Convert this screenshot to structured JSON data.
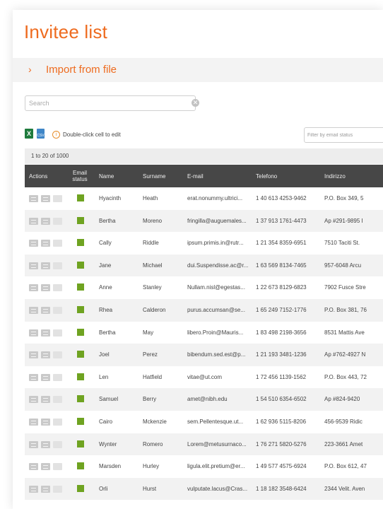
{
  "title": "Invitee list",
  "import": {
    "chevron": "›",
    "label": "Import from file"
  },
  "search": {
    "placeholder": "Search",
    "clear_glyph": "✕"
  },
  "toolbar": {
    "excel_glyph": "X",
    "csv_glyph": "CSV",
    "info_glyph": "i",
    "hint": "Double-click cell to edit",
    "filter_placeholder": "Filter by email status"
  },
  "range": "1 to 20 of 1000",
  "columns": {
    "actions": "Actions",
    "email_status": "Email status",
    "name": "Name",
    "surname": "Surname",
    "email": "E-mail",
    "telefono": "Telefono",
    "indirizzo": "Indirizzo"
  },
  "colors": {
    "accent": "#ee6b1f",
    "status_ok": "#6fa321",
    "header_bg": "#474747"
  },
  "rows": [
    {
      "name": "Hyacinth",
      "surname": "Heath",
      "email": "erat.nonummy.ultrici...",
      "phone": "1 40 613 4253-9462",
      "address": "P.O. Box 349, 5"
    },
    {
      "name": "Bertha",
      "surname": "Moreno",
      "email": "fringilla@auguemales...",
      "phone": "1 37 913 1761-4473",
      "address": "Ap #291-9895 I"
    },
    {
      "name": "Cally",
      "surname": "Riddle",
      "email": "ipsum.primis.in@rutr...",
      "phone": "1 21 354 8359-6951",
      "address": "7510 Taciti St."
    },
    {
      "name": "Jane",
      "surname": "Michael",
      "email": "dui.Suspendisse.ac@r...",
      "phone": "1 63 569 8134-7465",
      "address": "957-6048 Arcu"
    },
    {
      "name": "Anne",
      "surname": "Stanley",
      "email": "Nullam.nisl@egestas...",
      "phone": "1 22 673 8129-6823",
      "address": "7902 Fusce Stre"
    },
    {
      "name": "Rhea",
      "surname": "Calderon",
      "email": "purus.accumsan@se...",
      "phone": "1 65 249 7152-1776",
      "address": "P.O. Box 381, 76"
    },
    {
      "name": "Bertha",
      "surname": "May",
      "email": "libero.Proin@Mauris...",
      "phone": "1 83 498 2198-3656",
      "address": "8531 Mattis Ave"
    },
    {
      "name": "Joel",
      "surname": "Perez",
      "email": "bibendum.sed.est@p...",
      "phone": "1 21 193 3481-1236",
      "address": "Ap #762-4927 N"
    },
    {
      "name": "Len",
      "surname": "Hatfield",
      "email": "vitae@ut.com",
      "phone": "1 72 456 1139-1562",
      "address": "P.O. Box 443, 72"
    },
    {
      "name": "Samuel",
      "surname": "Berry",
      "email": "amet@nibh.edu",
      "phone": "1 54 510 6354-6502",
      "address": "Ap #824-9420"
    },
    {
      "name": "Cairo",
      "surname": "Mckenzie",
      "email": "sem.Pellentesque.ut...",
      "phone": "1 62 936 5115-8206",
      "address": "456-9539 Ridic"
    },
    {
      "name": "Wynter",
      "surname": "Romero",
      "email": "Lorem@metusurnaco...",
      "phone": "1 76 271 5820-5276",
      "address": "223-3661 Amet"
    },
    {
      "name": "Marsden",
      "surname": "Hurley",
      "email": "ligula.elit.pretium@er...",
      "phone": "1 49 577 4575-6924",
      "address": "P.O. Box 612, 47"
    },
    {
      "name": "Orli",
      "surname": "Hurst",
      "email": "vulputate.lacus@Cras...",
      "phone": "1 18 182 3548-6424",
      "address": "2344 Velit. Aven"
    }
  ]
}
